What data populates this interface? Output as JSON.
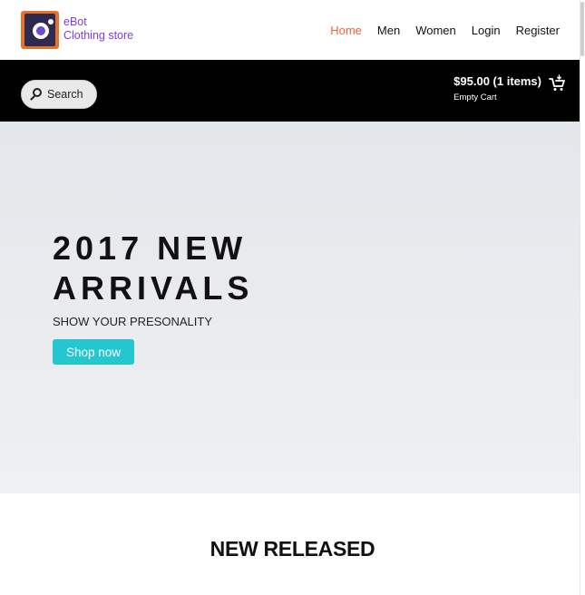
{
  "brand": {
    "line1": "eBot",
    "line2": "Clothing store"
  },
  "nav": {
    "items": [
      {
        "label": "Home",
        "active": true
      },
      {
        "label": "Men",
        "active": false
      },
      {
        "label": "Women",
        "active": false
      },
      {
        "label": "Login",
        "active": false
      },
      {
        "label": "Register",
        "active": false
      }
    ]
  },
  "search": {
    "label": "Search",
    "icon": "search-icon"
  },
  "cart": {
    "total": "$95.00 (1 items)",
    "empty_label": "Empty Cart",
    "icon": "cart-icon"
  },
  "hero": {
    "title_line1": "2017 NEW",
    "title_line2": "ARRIVALS",
    "subtitle": "SHOW YOUR PRESONALITY",
    "button_label": "Shop now"
  },
  "section": {
    "title": "NEW RELEASED"
  },
  "colors": {
    "accent_nav": "#e8633a",
    "brand": "#7b3fe4",
    "button": "#24c6cf",
    "topbar": "#000000"
  }
}
